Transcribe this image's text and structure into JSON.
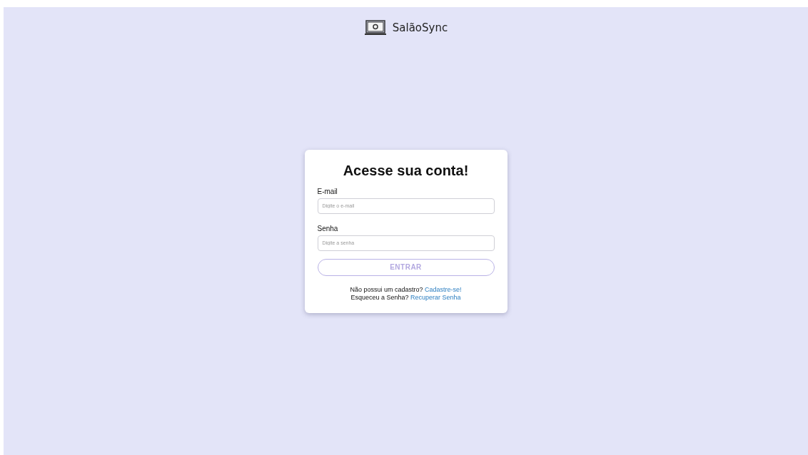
{
  "brand": {
    "name": "SalãoSync"
  },
  "login": {
    "title": "Acesse sua conta!",
    "fields": [
      {
        "label": "E-mail",
        "placeholder": "Digite o e-mail"
      },
      {
        "label": "Senha",
        "placeholder": "Digite a senha"
      }
    ],
    "button": {
      "label": "ENTRAR",
      "disabled": true
    },
    "links": [
      {
        "text": "Não possui um cadastro?",
        "link": "Cadastre-se!"
      },
      {
        "text": "Esqueceu a Senha?",
        "link": "Recuperar Senha"
      }
    ]
  }
}
